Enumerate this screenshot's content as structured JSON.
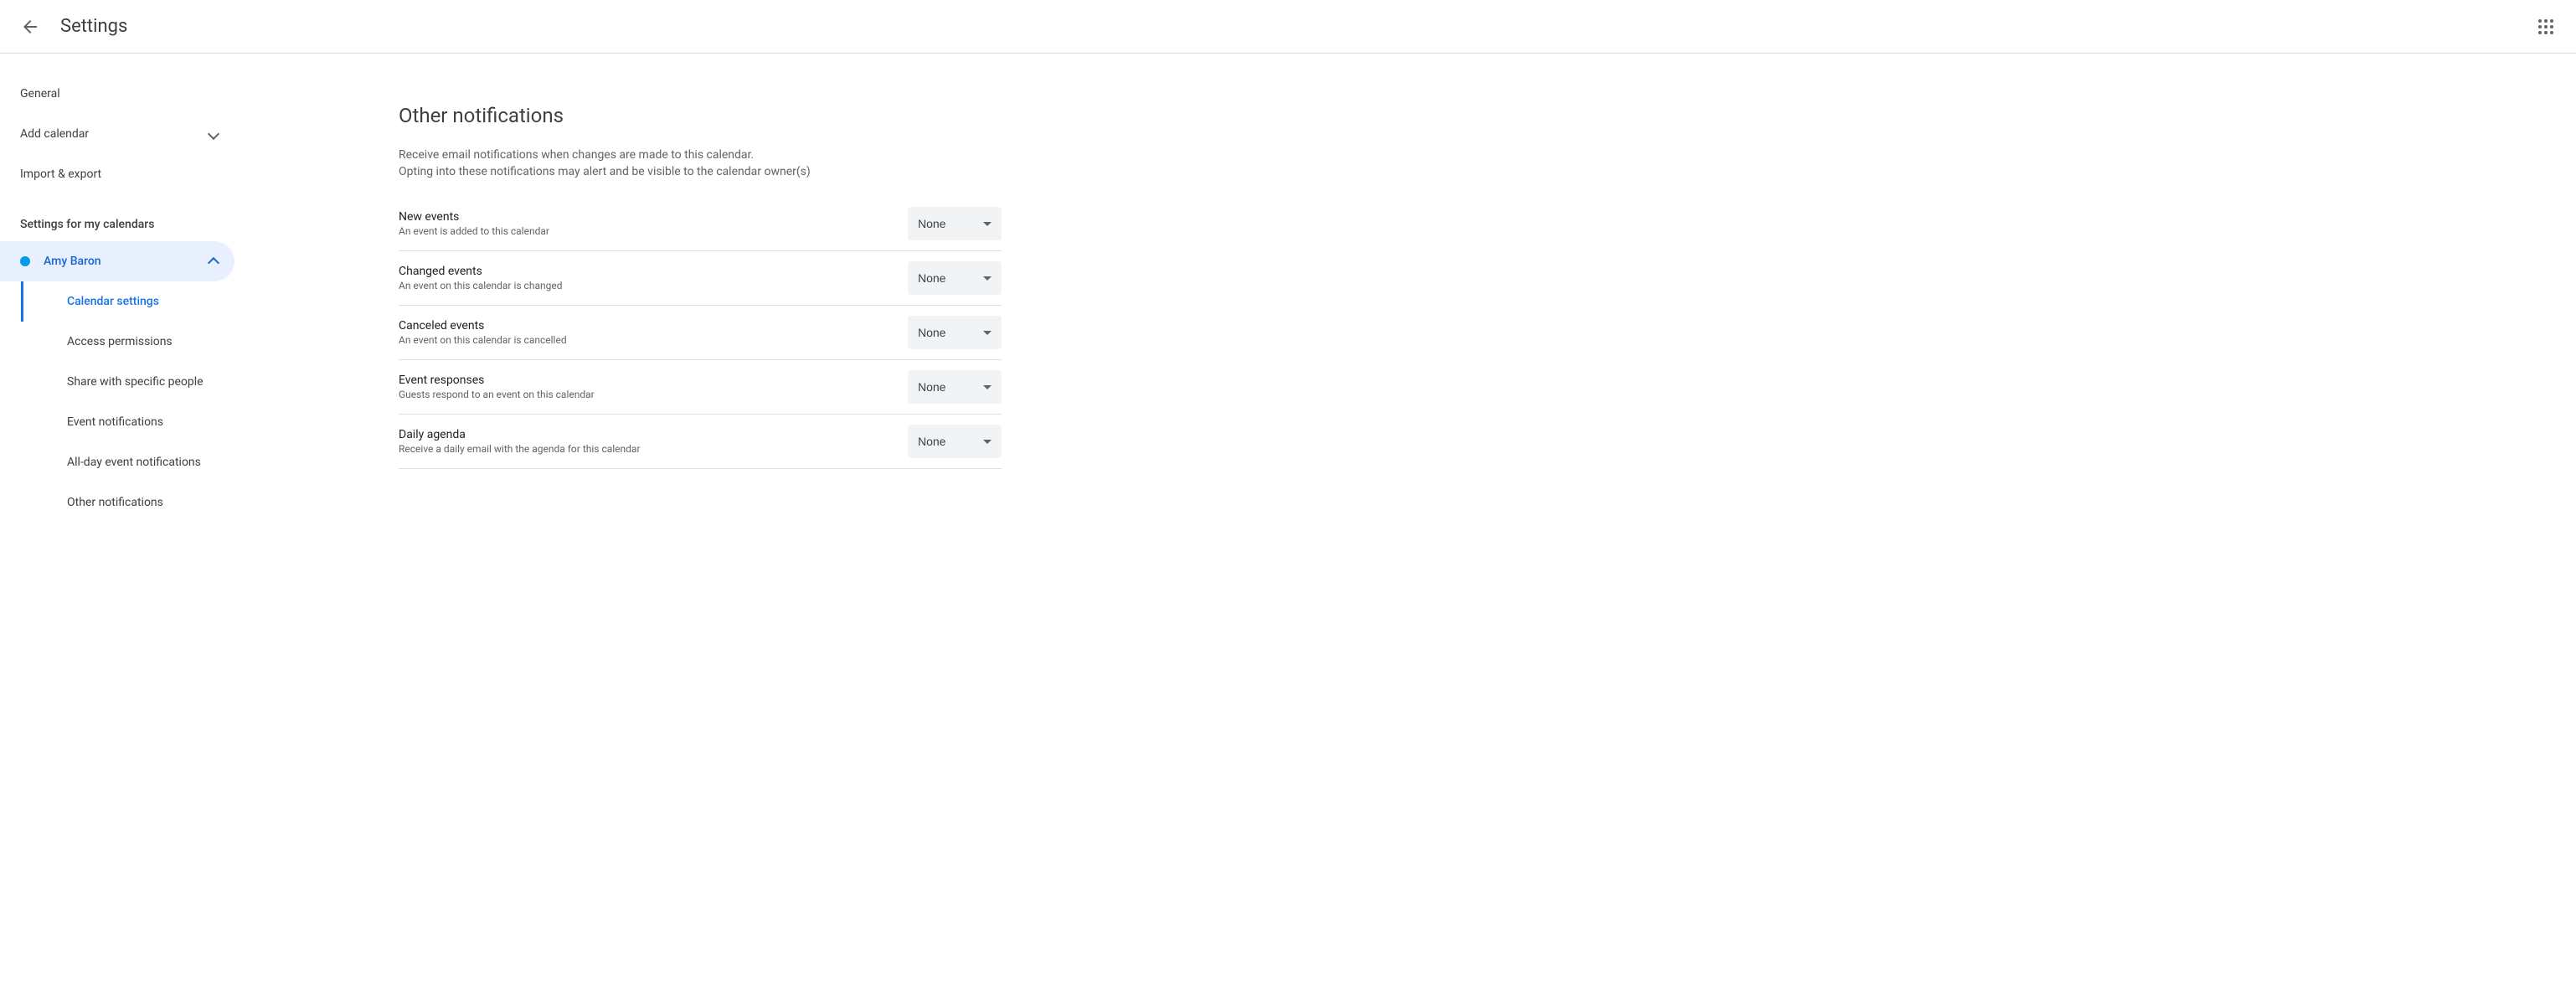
{
  "topbar": {
    "title": "Settings"
  },
  "sidebar": {
    "items": [
      {
        "label": "General"
      },
      {
        "label": "Add calendar"
      },
      {
        "label": "Import & export"
      }
    ],
    "section_header": "Settings for my calendars",
    "calendar": {
      "name": "Amy Baron"
    },
    "subitems": [
      {
        "label": "Calendar settings"
      },
      {
        "label": "Access permissions"
      },
      {
        "label": "Share with specific people"
      },
      {
        "label": "Event notifications"
      },
      {
        "label": "All-day event notifications"
      },
      {
        "label": "Other notifications"
      }
    ]
  },
  "main": {
    "title": "Other notifications",
    "desc_line1": "Receive email notifications when changes are made to this calendar.",
    "desc_line2": "Opting into these notifications may alert and be visible to the calendar owner(s)",
    "rows": [
      {
        "title": "New events",
        "desc": "An event is added to this calendar",
        "value": "None"
      },
      {
        "title": "Changed events",
        "desc": "An event on this calendar is changed",
        "value": "None"
      },
      {
        "title": "Canceled events",
        "desc": "An event on this calendar is cancelled",
        "value": "None"
      },
      {
        "title": "Event responses",
        "desc": "Guests respond to an event on this calendar",
        "value": "None"
      },
      {
        "title": "Daily agenda",
        "desc": "Receive a daily email with the agenda for this calendar",
        "value": "None"
      }
    ]
  }
}
